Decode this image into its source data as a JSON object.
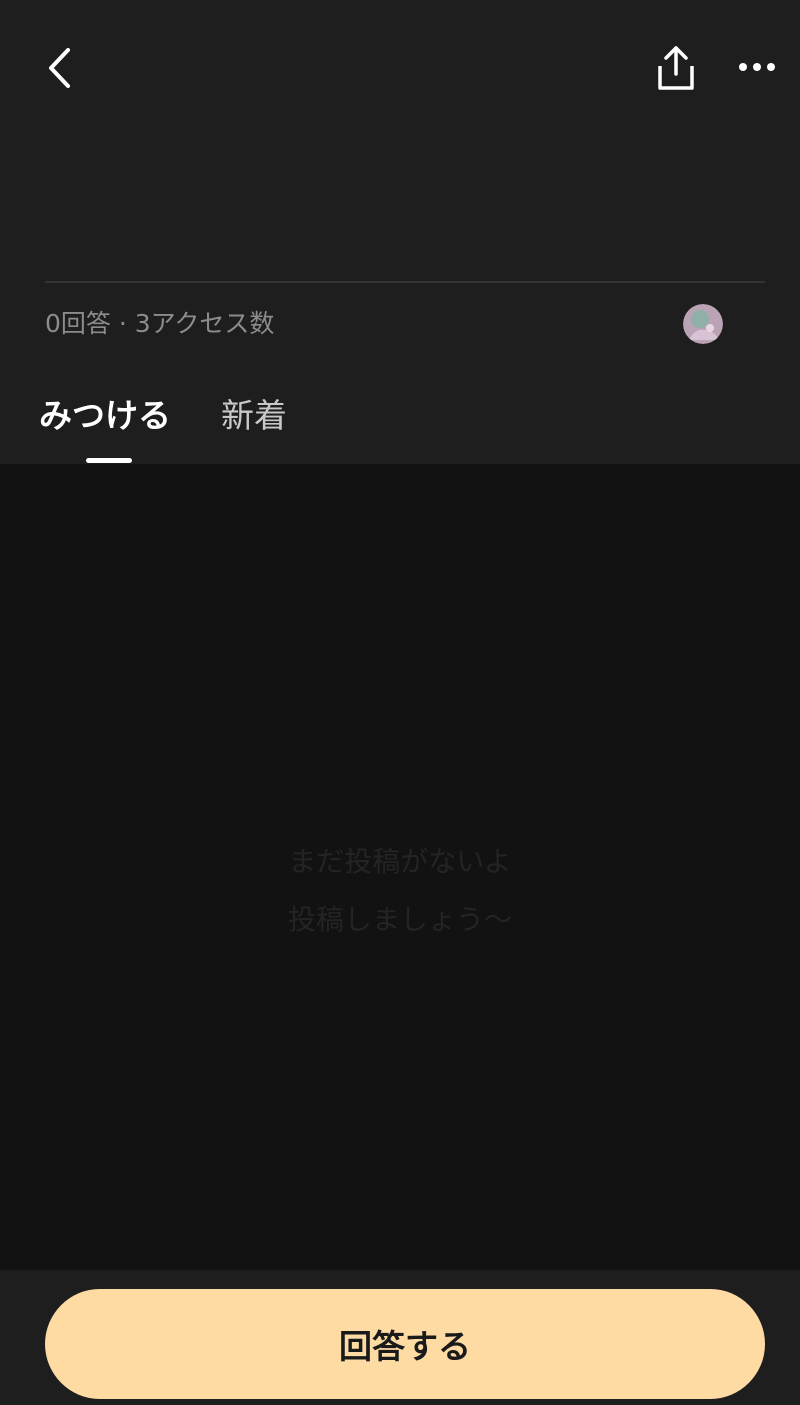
{
  "header": {
    "stats": "0回答 · 3アクセス数"
  },
  "tabs": [
    {
      "label": "みつける",
      "active": true
    },
    {
      "label": "新着",
      "active": false
    }
  ],
  "empty_state": {
    "line1": "まだ投稿がないよ",
    "line2": "投稿しましょう〜"
  },
  "footer": {
    "answer_button_label": "回答する"
  },
  "icons": {
    "back": "chevron-left-icon",
    "share": "share-upload-icon",
    "more": "more-dots-icon"
  },
  "colors": {
    "background": "#1e1e1e",
    "content_background": "#121212",
    "accent_button": "#ffdba4",
    "secondary_text": "#8c8c8c"
  }
}
